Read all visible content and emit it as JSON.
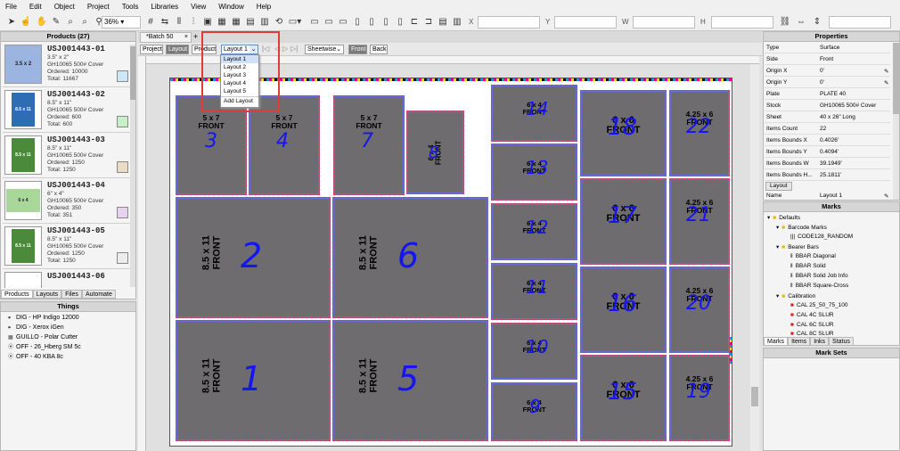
{
  "menu": [
    "File",
    "Edit",
    "Object",
    "Project",
    "Tools",
    "Libraries",
    "View",
    "Window",
    "Help"
  ],
  "toolbar": {
    "zoom": "36%"
  },
  "products_panel": {
    "title": "Products (27)",
    "items": [
      {
        "id": "USJ001443-01",
        "size": "3.5\" x 2\"",
        "stock": "GH10065 500# Cover",
        "ordered": "Ordered: 10000",
        "total": "Total: 11667",
        "thumb_color": "#9bb4e0",
        "thumb_text": "3.5 x 2",
        "swatch": "#cfe7f4"
      },
      {
        "id": "USJ001443-02",
        "size": "8.5\" x 11\"",
        "stock": "GH10065 500# Cover",
        "ordered": "Ordered: 600",
        "total": "Total: 600",
        "thumb_color": "#2e6db5",
        "thumb_text": "8.5 x 11",
        "swatch": "#c8efc8"
      },
      {
        "id": "USJ001443-03",
        "size": "8.5\" x 11\"",
        "stock": "GH10065 500# Cover",
        "ordered": "Ordered: 1250",
        "total": "Total: 1250",
        "thumb_color": "#4a8a3a",
        "thumb_text": "8.5 x 11",
        "swatch": "#e8dcc4"
      },
      {
        "id": "USJ001443-04",
        "size": "6\" x 4\"",
        "stock": "GH10065 500# Cover",
        "ordered": "Ordered: 350",
        "total": "Total: 351",
        "thumb_color": "#a9d79a",
        "thumb_text": "6 x 4",
        "swatch": "#e6d4ee"
      },
      {
        "id": "USJ001443-05",
        "size": "8.5\" x 11\"",
        "stock": "GH10065 500# Cover",
        "ordered": "Ordered: 1250",
        "total": "Total: 1250",
        "thumb_color": "#4a8a3a",
        "thumb_text": "8.5 x 11",
        "swatch": "#ececec"
      },
      {
        "id": "USJ001443-06",
        "size": "",
        "stock": "",
        "ordered": "",
        "total": "",
        "thumb_color": "#ffffff",
        "thumb_text": "",
        "swatch": "#ececec"
      }
    ],
    "tabs": [
      "Products",
      "Layouts",
      "Files",
      "Automate"
    ]
  },
  "things_panel": {
    "title": "Things",
    "items": [
      "DIG - HP Indigo 12000",
      "DIG - Xerox iGen",
      "GUILLO - Polar Cutter",
      "OFF - 26_Hberg SM 5c",
      "OFF - 40 KBA 8c"
    ]
  },
  "document": {
    "tab": "*Batch 50"
  },
  "subbar": {
    "project": "Project",
    "layout": "Layout",
    "product": "Product",
    "layout_select": "Layout 1",
    "sheetwise": "Sheetwise",
    "front": "Front",
    "back": "Back"
  },
  "dropdown": {
    "items": [
      "Layout 1",
      "Layout 2",
      "Layout 3",
      "Layout 4",
      "Layout 5"
    ],
    "add": "Add Layout"
  },
  "properties": {
    "title": "Properties",
    "rows": [
      {
        "k": "Type",
        "v": "Surface"
      },
      {
        "k": "Side",
        "v": "Front"
      },
      {
        "k": "Origin X",
        "v": "0'"
      },
      {
        "k": "Origin Y",
        "v": "0'"
      },
      {
        "k": "Plate",
        "v": "PLATE 40"
      },
      {
        "k": "Stock",
        "v": "GH10065 500# Cover"
      },
      {
        "k": "Sheet",
        "v": "40 x 26\" Long"
      },
      {
        "k": "Items Count",
        "v": "22"
      },
      {
        "k": "Items Bounds X",
        "v": "0.4026'"
      },
      {
        "k": "Items Bounds Y",
        "v": "0.4094'"
      },
      {
        "k": "Items Bounds W",
        "v": "39.1949'"
      },
      {
        "k": "Items Bounds H...",
        "v": "25.1811'"
      }
    ],
    "layout_section": "Layout",
    "layout_name_key": "Name",
    "layout_name_val": "Layout 1"
  },
  "marks_panel": {
    "title": "Marks",
    "items": [
      "Defaults",
      "Barcode Marks",
      "CODE128_RANDOM",
      "Bearer Bars",
      "BBAR Diagonal",
      "BBAR Solid",
      "BBAR Solid Job Info",
      "BBAR Square-Cross",
      "Calibration",
      "CAL 25_50_75_100",
      "CAL 4C SLUR",
      "CAL 6C SLUR",
      "CAL 8C SLUR"
    ],
    "tabs": [
      "Marks",
      "Items",
      "Inks",
      "Status"
    ]
  },
  "mark_sets_panel": {
    "title": "Mark Sets"
  },
  "tiles": [
    {
      "num": "3",
      "label": "5 x 7\nFRONT"
    },
    {
      "num": "4",
      "label": "5 x 7\nFRONT"
    },
    {
      "num": "7",
      "label": "5 x 7\nFRONT"
    },
    {
      "num": "8",
      "label": "6 x 4\nFRONT"
    },
    {
      "num": "2",
      "label": "8.5 x 11\nFRONT"
    },
    {
      "num": "6",
      "label": "8.5 x 11\nFRONT"
    },
    {
      "num": "1",
      "label": "8.5 x 11\nFRONT"
    },
    {
      "num": "5",
      "label": "8.5 x 11\nFRONT"
    },
    {
      "num": "14",
      "label": "6 x 4\nFRONT"
    },
    {
      "num": "13",
      "label": "6 x 4\nFRONT"
    },
    {
      "num": "12",
      "label": "6 x 4\nFRONT"
    },
    {
      "num": "11",
      "label": "6 x 4\nFRONT"
    },
    {
      "num": "10",
      "label": "6 x 4\nFRONT"
    },
    {
      "num": "9",
      "label": "6 x 4\nFRONT"
    },
    {
      "num": "18",
      "label": "6 x 6\nFRONT"
    },
    {
      "num": "17",
      "label": "6 x 6\nFRONT"
    },
    {
      "num": "16",
      "label": "6 x 6\nFRONT"
    },
    {
      "num": "15",
      "label": "6 x 6\nFRONT"
    },
    {
      "num": "22",
      "label": "4.25 x 6\nFRONT"
    },
    {
      "num": "21",
      "label": "4.25 x 6\nFRONT"
    },
    {
      "num": "20",
      "label": "4.25 x 6\nFRONT"
    },
    {
      "num": "19",
      "label": "4.25 x 6\nFRONT"
    }
  ]
}
